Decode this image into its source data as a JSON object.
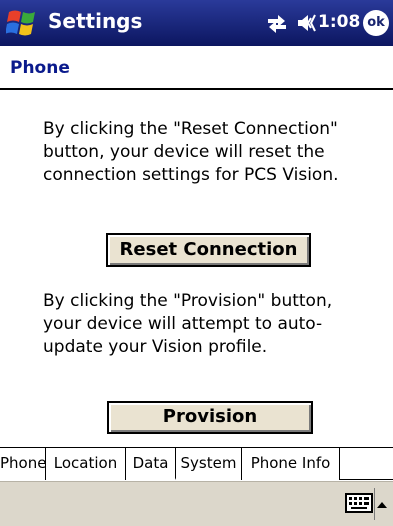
{
  "titlebar": {
    "title": "Settings",
    "clock": "1:08",
    "ok_label": "ok",
    "start_icon": "windows-flag-icon",
    "connectivity_icon": "connectivity-arrows-icon",
    "volume_icon": "speaker-icon"
  },
  "page": {
    "header": "Phone",
    "reset_text": "By clicking the \"Reset Connection\" button, your device will reset the connection settings for PCS Vision.",
    "reset_button": "Reset Connection",
    "provision_text": "By clicking the \"Provision\" button, your device will attempt to auto-update your Vision profile.",
    "provision_button": "Provision"
  },
  "tabs": [
    {
      "label": "Phone",
      "active": false
    },
    {
      "label": "Location",
      "active": false
    },
    {
      "label": "Data",
      "active": true
    },
    {
      "label": "System",
      "active": false
    },
    {
      "label": "Phone Info",
      "active": false
    }
  ],
  "menubar": {
    "keyboard_icon": "keyboard-icon",
    "sip_arrow_icon": "sip-up-arrow-icon"
  },
  "colors": {
    "titlebar": "#18246e",
    "header_text": "#0a1a8c",
    "button_face": "#eae3d1",
    "menubar": "#dcd7cb"
  }
}
